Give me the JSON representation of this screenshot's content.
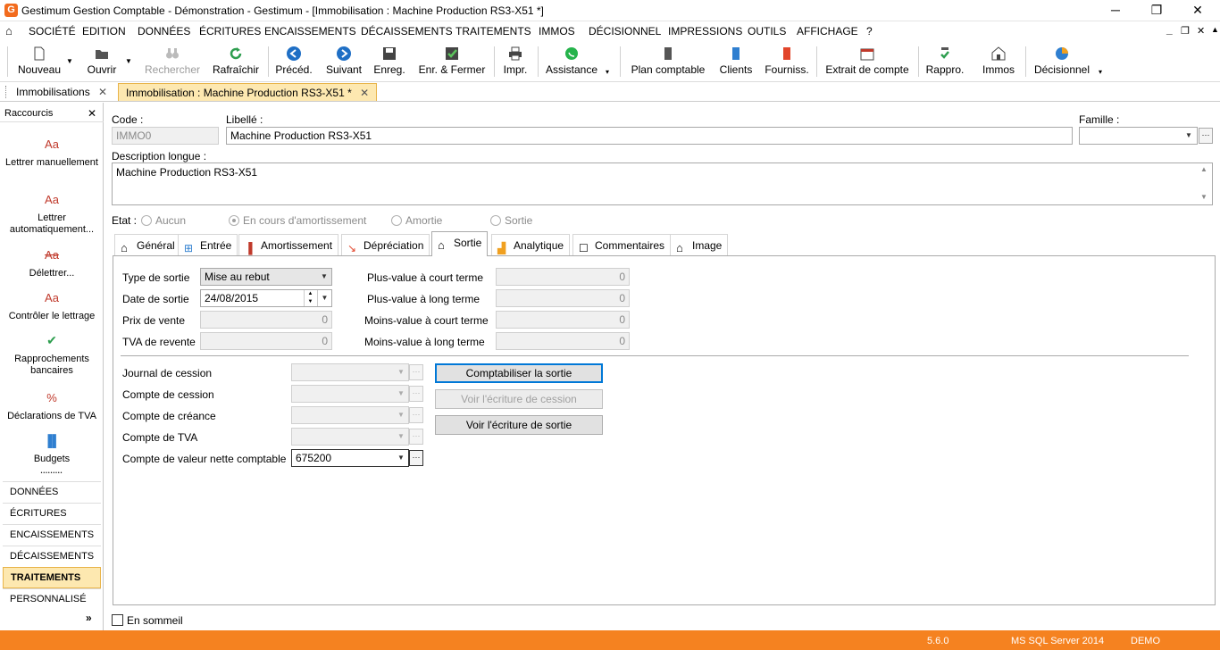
{
  "window": {
    "title": "Gestimum Gestion Comptable - Démonstration - Gestimum - [Immobilisation : Machine Production RS3-X51 *]",
    "minimize": "─",
    "maximize": "❐",
    "close": "✕"
  },
  "menu": {
    "items": [
      "SOCIÉTÉ",
      "EDITION",
      "DONNÉES",
      "ÉCRITURES",
      "ENCAISSEMENTS",
      "DÉCAISSEMENTS",
      "TRAITEMENTS",
      "IMMOS",
      "DÉCISIONNEL",
      "IMPRESSIONS",
      "OUTILS",
      "AFFICHAGE",
      "?"
    ],
    "mdi_minimize": "_",
    "mdi_restore": "❐",
    "mdi_close": "✕"
  },
  "toolbar": {
    "nouveau": "Nouveau",
    "ouvrir": "Ouvrir",
    "rechercher": "Rechercher",
    "rafraichir": "Rafraîchir",
    "precedent": "Précéd.",
    "suivant": "Suivant",
    "enregistrer": "Enreg.",
    "enr_fermer": "Enr. & Fermer",
    "imprimer": "Impr.",
    "assistance": "Assistance",
    "plan_comptable": "Plan comptable",
    "clients": "Clients",
    "fournisseurs": "Fourniss.",
    "extrait_compte": "Extrait de compte",
    "rappro": "Rappro.",
    "immos": "Immos",
    "decisionnel": "Décisionnel"
  },
  "doc_tabs": [
    {
      "label": "Immobilisations"
    },
    {
      "label": "Immobilisation : Machine Production RS3-X51 *"
    }
  ],
  "sidebar": {
    "title": "Raccourcis",
    "shortcuts": [
      "Lettrer manuellement",
      "Lettrer automatiquement...",
      "Délettrer...",
      "Contrôler le lettrage",
      "Rapprochements bancaires",
      "Déclarations de TVA",
      "Budgets"
    ],
    "dots": "•••••••••",
    "sections": [
      "DONNÉES",
      "ÉCRITURES",
      "ENCAISSEMENTS",
      "DÉCAISSEMENTS",
      "TRAITEMENTS",
      "PERSONNALISÉ"
    ],
    "active_section": "TRAITEMENTS",
    "more": "»"
  },
  "form": {
    "code_label": "Code :",
    "code_value": "IMMO0",
    "libelle_label": "Libellé :",
    "libelle_value": "Machine Production RS3-X51",
    "famille_label": "Famille :",
    "famille_value": "",
    "desc_label": "Description longue :",
    "desc_value": "Machine Production RS3-X51",
    "etat_label": "Etat :",
    "etat_options": [
      "Aucun",
      "En cours d'amortissement",
      "Amortie",
      "Sortie"
    ],
    "etat_selected": "En cours d'amortissement"
  },
  "tabs": [
    "Général",
    "Entrée",
    "Amortissement",
    "Dépréciation",
    "Sortie",
    "Analytique",
    "Commentaires",
    "Image"
  ],
  "selected_tab": "Sortie",
  "sortie": {
    "type_label": "Type de sortie",
    "type_value": "Mise au rebut",
    "date_label": "Date de sortie",
    "date_value": "24/08/2015",
    "prix_label": "Prix de vente",
    "prix_value": "0",
    "tva_label": "TVA de revente",
    "tva_value": "0",
    "pv_court_label": "Plus-value à court terme",
    "pv_court_value": "0",
    "pv_long_label": "Plus-value à long terme",
    "pv_long_value": "0",
    "mv_court_label": "Moins-value à court terme",
    "mv_court_value": "0",
    "mv_long_label": "Moins-value à long terme",
    "mv_long_value": "0",
    "journal_label": "Journal de cession",
    "journal_value": "",
    "compte_cession_label": "Compte de cession",
    "compte_cession_value": "",
    "compte_creance_label": "Compte de créance",
    "compte_creance_value": "",
    "compte_tva_label": "Compte de TVA",
    "compte_tva_value": "",
    "compte_vnc_label": "Compte de valeur nette comptable",
    "compte_vnc_value": "675200",
    "btn_comptabiliser": "Comptabiliser la sortie",
    "btn_voir_cession": "Voir l'écriture de cession",
    "btn_voir_sortie": "Voir l'écriture de sortie"
  },
  "sommeil_label": "En sommeil",
  "status": {
    "version": "5.6.0",
    "server": "MS SQL Server 2014",
    "db": "DEMO"
  },
  "colors": {
    "accent": "#f58220",
    "active_tab": "#fde8b0"
  }
}
